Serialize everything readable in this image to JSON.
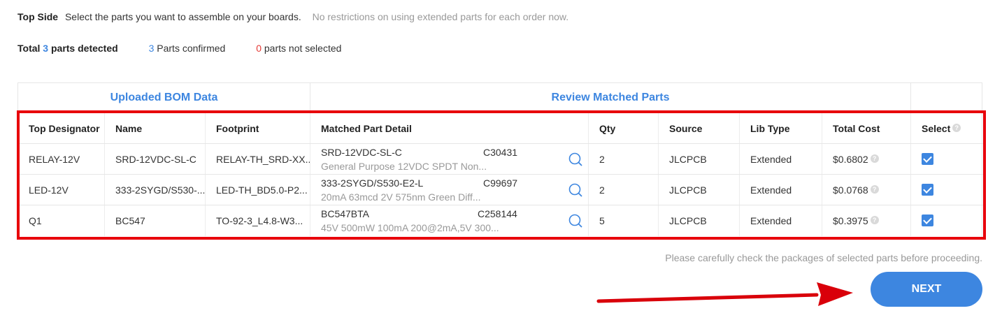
{
  "top": {
    "label": "Top Side",
    "instruction": "Select the parts you want to assemble on your boards.",
    "note": "No restrictions on using extended parts for each order now."
  },
  "summary": {
    "total_prefix": "Total",
    "total_count": "3",
    "total_suffix": "parts detected",
    "confirmed_count": "3",
    "confirmed_label": "Parts confirmed",
    "not_selected_count": "0",
    "not_selected_label": "parts not selected"
  },
  "sections": {
    "uploaded": "Uploaded BOM Data",
    "review": "Review Matched Parts"
  },
  "columns": {
    "designator": "Top Designator",
    "name": "Name",
    "footprint": "Footprint",
    "detail": "Matched Part Detail",
    "qty": "Qty",
    "source": "Source",
    "lib_type": "Lib Type",
    "total_cost": "Total Cost",
    "select": "Select"
  },
  "rows": [
    {
      "designator": "RELAY-12V",
      "name": "SRD-12VDC-SL-C",
      "footprint": "RELAY-TH_SRD-XX...",
      "mpn": "SRD-12VDC-SL-C",
      "lcsc": "C30431",
      "description": "General Purpose 12VDC SPDT Non...",
      "qty": "2",
      "source": "JLCPCB",
      "lib_type": "Extended",
      "cost": "$0.6802",
      "selected": true
    },
    {
      "designator": "LED-12V",
      "name": "333-2SYGD/S530-...",
      "footprint": "LED-TH_BD5.0-P2...",
      "mpn": "333-2SYGD/S530-E2-L",
      "lcsc": "C99697",
      "description": "20mA 63mcd 2V 575nm Green Diff...",
      "qty": "2",
      "source": "JLCPCB",
      "lib_type": "Extended",
      "cost": "$0.0768",
      "selected": true
    },
    {
      "designator": "Q1",
      "name": "BC547",
      "footprint": "TO-92-3_L4.8-W3...",
      "mpn": "BC547BTA",
      "lcsc": "C258144",
      "description": "45V 500mW 100mA 200@2mA,5V 300...",
      "qty": "5",
      "source": "JLCPCB",
      "lib_type": "Extended",
      "cost": "$0.3975",
      "selected": true
    }
  ],
  "footer": {
    "warning": "Please carefully check the packages of selected parts before proceeding.",
    "next_label": "NEXT"
  },
  "colors": {
    "accent": "#3d86e0",
    "highlight": "#e8000b",
    "muted": "#999999"
  }
}
